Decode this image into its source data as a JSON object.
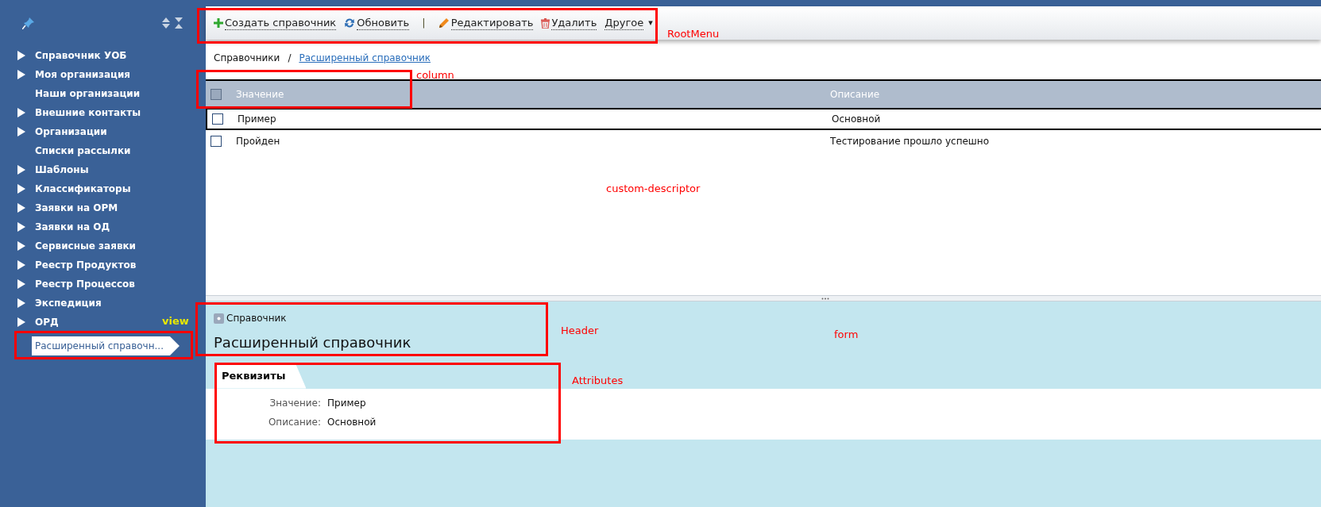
{
  "sidebar": {
    "items": [
      {
        "label": "Справочник УОБ",
        "kind": "folder",
        "expanded": false,
        "selected": false
      },
      {
        "label": "Моя организация",
        "kind": "folder",
        "expanded": false,
        "selected": false
      },
      {
        "label": "Наши организации",
        "kind": "leaf",
        "selected": false
      },
      {
        "label": "Внешние контакты",
        "kind": "folder",
        "expanded": false,
        "selected": false
      },
      {
        "label": "Организации",
        "kind": "folder",
        "expanded": false,
        "selected": false
      },
      {
        "label": "Списки рассылки",
        "kind": "leaf",
        "selected": false
      },
      {
        "label": "Шаблоны",
        "kind": "folder",
        "expanded": false,
        "selected": false
      },
      {
        "label": "Классификаторы",
        "kind": "folder",
        "expanded": false,
        "selected": false
      },
      {
        "label": "Заявки на ОРМ",
        "kind": "folder",
        "expanded": false,
        "selected": false
      },
      {
        "label": "Заявки на ОД",
        "kind": "folder",
        "expanded": false,
        "selected": false
      },
      {
        "label": "Сервисные заявки",
        "kind": "folder",
        "expanded": false,
        "selected": false
      },
      {
        "label": "Реестр Продуктов",
        "kind": "folder",
        "expanded": false,
        "selected": false
      },
      {
        "label": "Реестр Процессов",
        "kind": "folder",
        "expanded": false,
        "selected": false
      },
      {
        "label": "Экспедиция",
        "kind": "folder",
        "expanded": false,
        "selected": false
      },
      {
        "label": "ОРД",
        "kind": "folder",
        "expanded": false,
        "selected": false
      },
      {
        "label": "Расширенный справочн...",
        "kind": "leaf",
        "selected": true
      }
    ]
  },
  "toolbar": {
    "items": [
      {
        "kind": "create",
        "label": "Создать справочник"
      },
      {
        "kind": "refresh",
        "label": "Обновить"
      },
      {
        "kind": "separator",
        "label": "|"
      },
      {
        "kind": "edit",
        "label": "Редактировать"
      },
      {
        "kind": "delete",
        "label": "Удалить"
      },
      {
        "kind": "dropdown",
        "label": "Другое",
        "caret": "▾"
      }
    ]
  },
  "breadcrumb": [
    {
      "label": "Справочники",
      "kind": "text"
    },
    {
      "label": "/",
      "kind": "separator"
    },
    {
      "label": "Расширенный справочник",
      "kind": "link"
    }
  ],
  "table": {
    "header_checked": false,
    "columns": [
      "Значение",
      "Описание"
    ],
    "rows": [
      {
        "checked": false,
        "selected": true,
        "cells": [
          "Пример",
          "Основной"
        ]
      },
      {
        "checked": false,
        "selected": false,
        "cells": [
          "Пройден",
          "Тестирование прошло успешно"
        ]
      }
    ]
  },
  "form": {
    "type": "Справочник",
    "title": "Расширенный справочник",
    "tabs": [
      {
        "label": "Реквизиты",
        "selected": true
      }
    ],
    "fields": [
      {
        "label": "Значение:",
        "value": "Пример"
      },
      {
        "label": "Описание:",
        "value": "Основной"
      }
    ]
  },
  "annotations": [
    {
      "label": "RootMenu",
      "color": "#ff0000",
      "boxed": true
    },
    {
      "label": "column",
      "color": "#ff0000",
      "boxed": true
    },
    {
      "label": "custom-descriptor",
      "color": "#ff0000",
      "boxed": false
    },
    {
      "label": "view",
      "color": "#e8e800",
      "boxed": true
    },
    {
      "label": "Header",
      "color": "#ff0000",
      "boxed": true
    },
    {
      "label": "form",
      "color": "#ff0000",
      "boxed": false
    },
    {
      "label": "Attributes",
      "color": "#ff0000",
      "boxed": true
    }
  ]
}
